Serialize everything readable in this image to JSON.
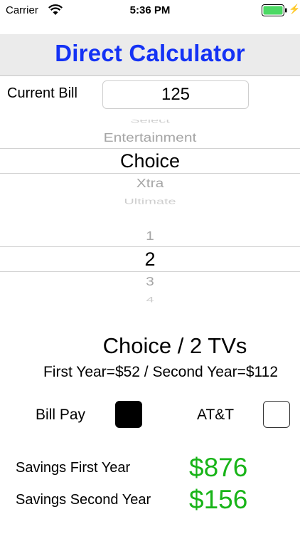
{
  "status": {
    "carrier": "Carrier",
    "time": "5:36 PM",
    "battery_color": "#4cd964"
  },
  "header": {
    "title": "Direct Calculator"
  },
  "bill": {
    "label": "Current Bill",
    "value": "125"
  },
  "package_picker": {
    "items": [
      "Select",
      "Entertainment",
      "Choice",
      "Xtra",
      "Ultimate"
    ],
    "selected": "Choice"
  },
  "tv_picker": {
    "items": [
      "1",
      "2",
      "3",
      "4"
    ],
    "selected": "2"
  },
  "summary": {
    "title": "Choice / 2 TVs",
    "subtitle": "First Year=$52 / Second Year=$112"
  },
  "options": {
    "bill_pay": {
      "label": "Bill Pay",
      "checked": true
    },
    "att": {
      "label": "AT&T",
      "checked": false
    }
  },
  "savings": {
    "first_year_label": "Savings First Year",
    "first_year_value": "$876",
    "second_year_label": "Savings Second Year",
    "second_year_value": "$156"
  },
  "colors": {
    "title": "#1432f5",
    "savings": "#18b418",
    "header_bg": "#ebebeb"
  }
}
